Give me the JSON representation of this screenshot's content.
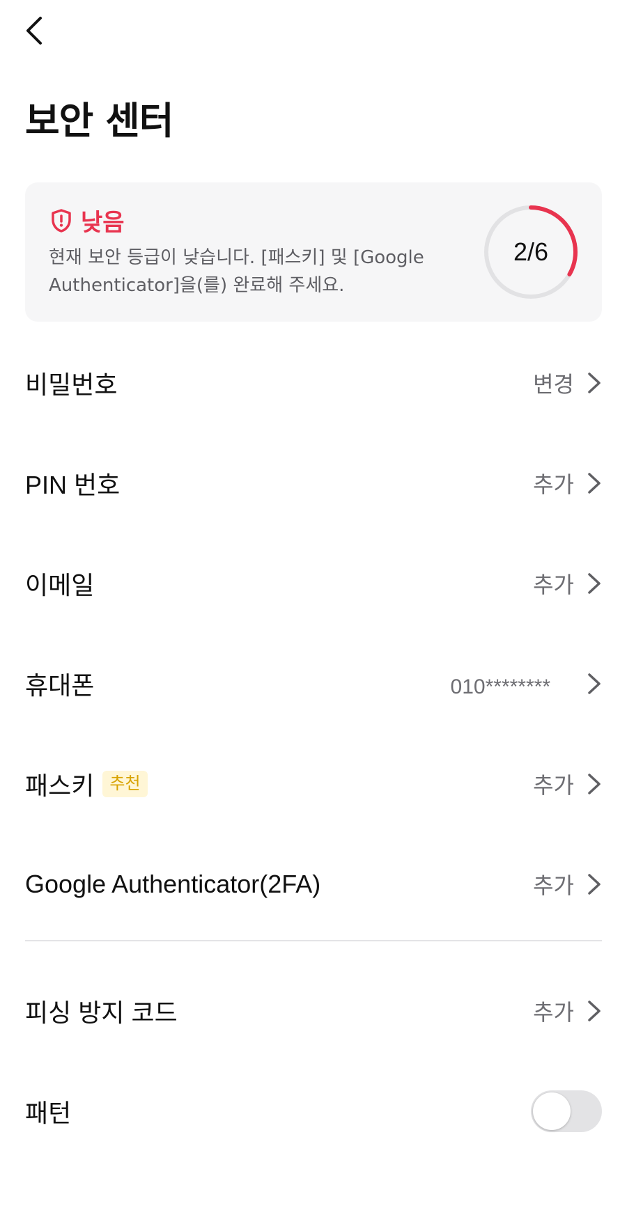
{
  "header": {
    "back_icon": "chevron-left-icon",
    "title": "보안 센터"
  },
  "security_level": {
    "icon": "shield-alert-icon",
    "label": "낮음",
    "description": "현재 보안 등급이 낮습니다. [패스키] 및 [Google Authenticator]을(를) 완료해 주세요.",
    "progress_text": "2/6",
    "completed": 2,
    "total": 6,
    "accent_color": "#e8344f"
  },
  "menu": {
    "items": [
      {
        "label": "비밀번호",
        "value": "변경"
      },
      {
        "label": "PIN 번호",
        "value": "추가"
      },
      {
        "label": "이메일",
        "value": "추가"
      },
      {
        "label": "휴대폰",
        "value": "010********"
      },
      {
        "label": "패스키",
        "badge": "추천",
        "value": "추가"
      },
      {
        "label": "Google Authenticator(2FA)",
        "value": "추가"
      }
    ],
    "extra_items": [
      {
        "label": "피싱 방지 코드",
        "value": "추가"
      },
      {
        "label": "패턴",
        "toggle_on": false
      }
    ]
  }
}
